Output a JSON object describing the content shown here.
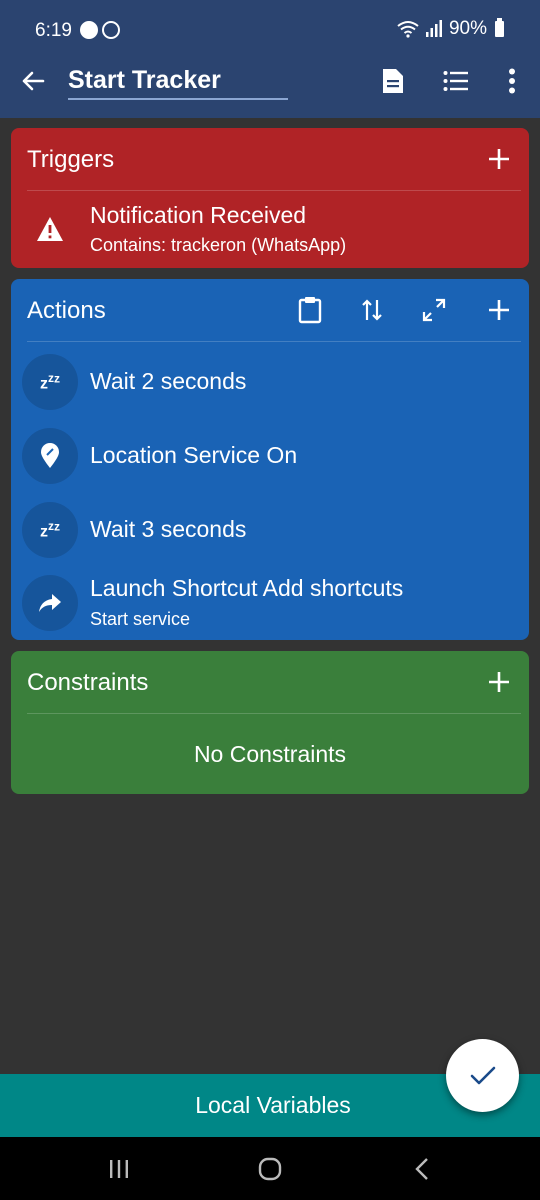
{
  "status_bar": {
    "time": "6:19",
    "battery": "90%",
    "notification_icons": [
      "chat-app-icon",
      "whatsapp-icon"
    ],
    "system_icons": [
      "wifi-icon",
      "signal-icon",
      "battery-icon"
    ]
  },
  "app_bar": {
    "title": "Start Tracker",
    "actions": [
      "back-arrow-icon",
      "document-icon",
      "list-icon",
      "more-vert-icon"
    ]
  },
  "triggers": {
    "title": "Triggers",
    "items": [
      {
        "icon": "warning-icon",
        "label": "Notification Received",
        "sub": "Contains: trackeron (WhatsApp)"
      }
    ]
  },
  "actions": {
    "title": "Actions",
    "header_icons": [
      "clipboard-icon",
      "sort-icon",
      "expand-icon",
      "add-icon"
    ],
    "items": [
      {
        "icon": "zzz-icon",
        "label": "Wait 2 seconds"
      },
      {
        "icon": "location-pin-icon",
        "label": "Location Service On"
      },
      {
        "icon": "zzz-icon",
        "label": "Wait 3 seconds"
      },
      {
        "icon": "share-arrow-icon",
        "label": "Launch Shortcut Add shortcuts",
        "sub": "Start service"
      }
    ]
  },
  "constraints": {
    "title": "Constraints",
    "empty_text": "No Constraints"
  },
  "bottom_bar": {
    "label": "Local Variables"
  },
  "fab": {
    "icon": "check-icon"
  },
  "colors": {
    "app_bar": "#2b4470",
    "triggers": "#b02326",
    "actions": "#1a63b5",
    "constraints": "#3a7f3b",
    "local_variables": "#008787",
    "background": "#333333"
  }
}
